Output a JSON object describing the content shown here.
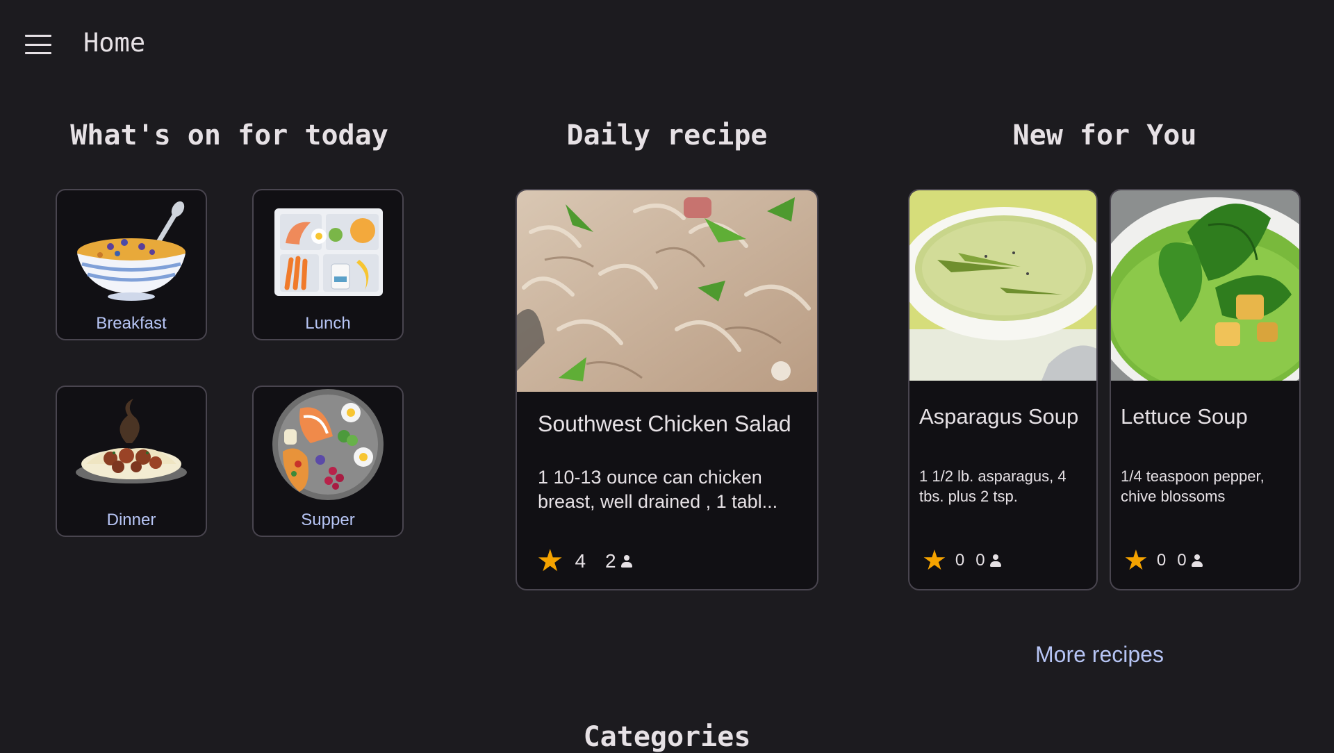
{
  "appbar": {
    "title": "Home",
    "menu_icon": "hamburger-menu-icon"
  },
  "sections": {
    "today_title": "What's on for today",
    "daily_title": "Daily recipe",
    "new_title": "New for You",
    "categories_title": "Categories"
  },
  "meals": [
    {
      "label": "Breakfast",
      "icon": "cereal-bowl-icon"
    },
    {
      "label": "Lunch",
      "icon": "lunch-tray-icon"
    },
    {
      "label": "Dinner",
      "icon": "pasta-plate-icon"
    },
    {
      "label": "Supper",
      "icon": "food-platter-icon"
    }
  ],
  "daily_recipe": {
    "name": "Southwest Chicken Salad",
    "description": "1 10-13 ounce can chicken breast, well drained , 1 tabl...",
    "rating": "4",
    "people": "2"
  },
  "new_for_you": [
    {
      "name": "Asparagus Soup",
      "description": "1 1/2 lb. asparagus, 4 tbs. plus 2 tsp.",
      "rating": "0",
      "people": "0"
    },
    {
      "name": "Lettuce Soup",
      "description": "1/4 teaspoon pepper, chive blossoms",
      "rating": "0",
      "people": "0"
    }
  ],
  "more_link": "More recipes",
  "colors": {
    "background": "#1c1b1f",
    "accent": "#b7c5f5",
    "star": "#f5a300",
    "card": "#111014",
    "border": "#49454f"
  }
}
